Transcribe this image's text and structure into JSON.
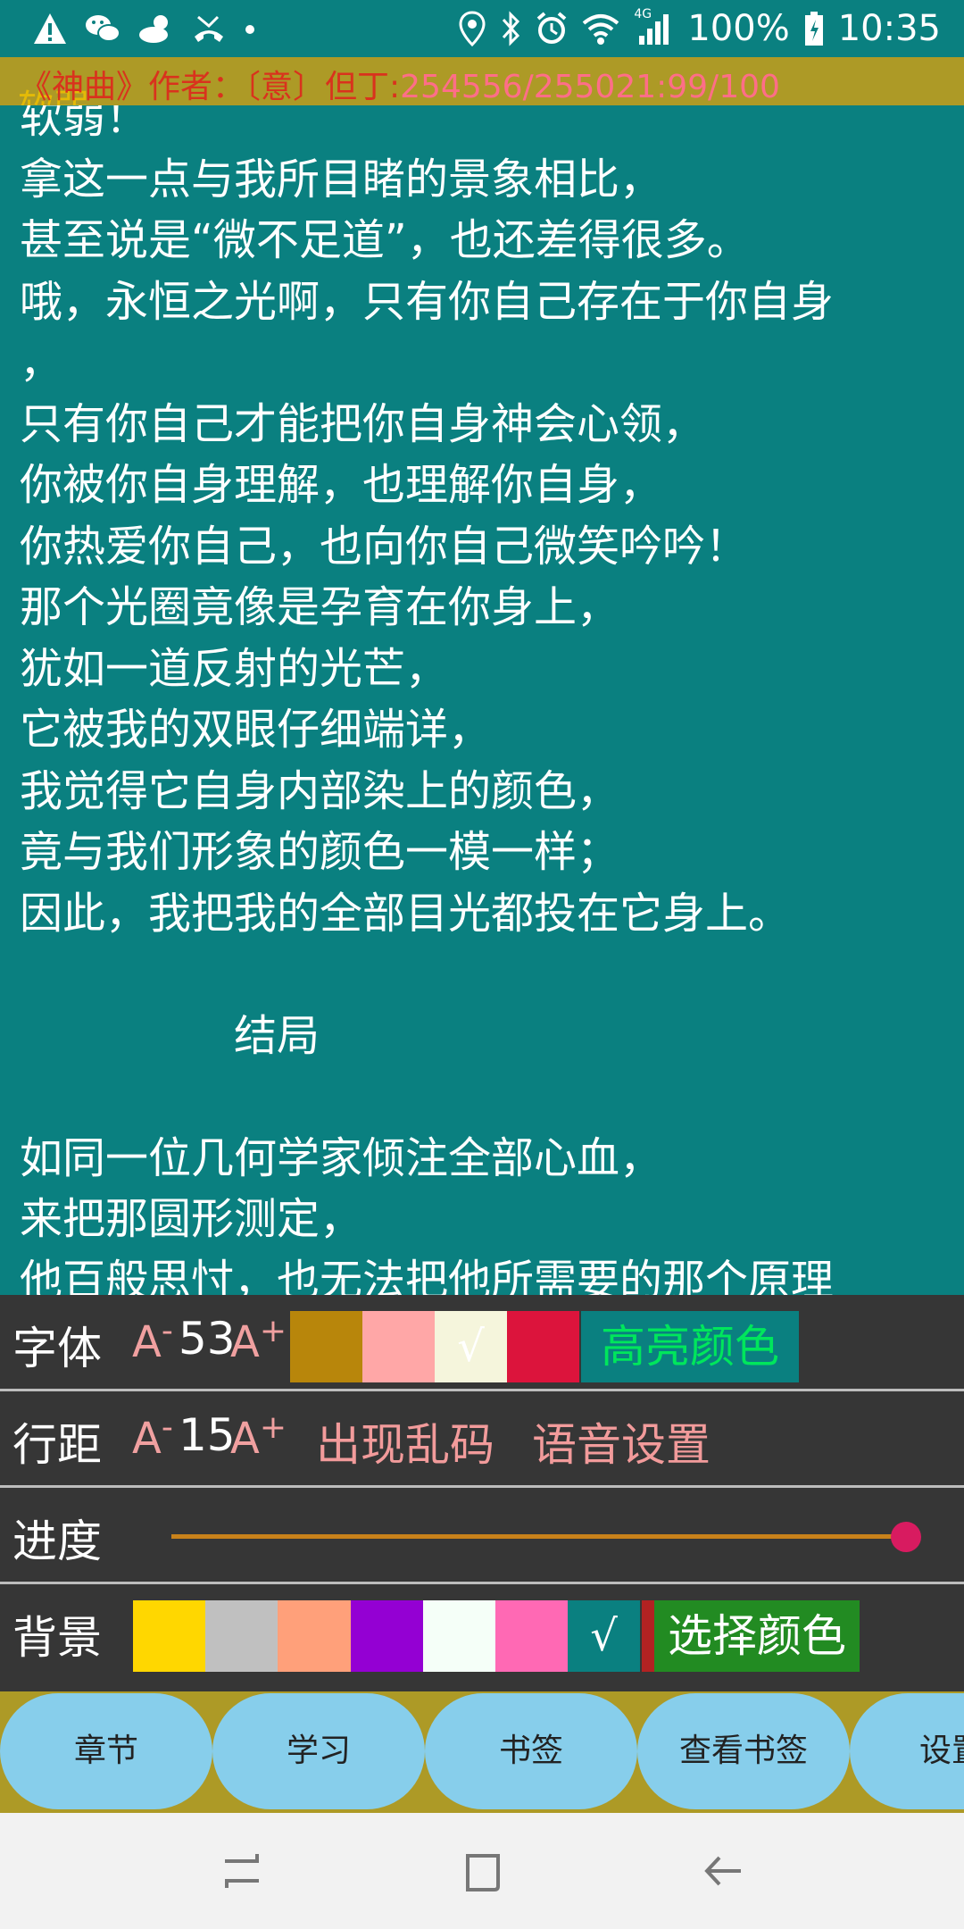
{
  "status_bar": {
    "icons_left": [
      "warning-icon",
      "wechat-icon",
      "weather-icon",
      "missed-call-icon",
      "dot-icon"
    ],
    "icons_right": [
      "location-icon",
      "bluetooth-icon",
      "alarm-icon",
      "wifi-icon",
      "signal-icon",
      "battery-icon"
    ],
    "network_label": "4G",
    "battery": "100%",
    "time": "10:35"
  },
  "header": {
    "book": "《神曲》作者：〔意〕但丁:",
    "progress": "254556/255021:99/100",
    "ghost_text": "软弱"
  },
  "reader": {
    "lines": [
      "软弱！",
      "拿这一点与我所目睹的景象相比，",
      "甚至说是“微不足道”，也还差得很多。",
      "哦，永恒之光啊，只有你自己存在于你自身",
      "，",
      "只有你自己才能把你自身神会心领，",
      "你被你自身理解，也理解你自身，",
      "你热爱你自己，也向你自己微笑吟吟！",
      "那个光圈竟像是孕育在你身上，",
      "犹如一道反射的光芒，",
      "它被我的双眼仔细端详，",
      "我觉得它自身内部染上的颜色，",
      "竟与我们形象的颜色一模一样；",
      "因此，我把我的全部目光都投在它身上。",
      "",
      "　　　　　结局",
      "",
      "如同一位几何学家倾注全部心血，",
      "来把那圆形测定，",
      "他百般思忖，也无法把他所需要的那个原理"
    ]
  },
  "settings": {
    "font": {
      "label": "字体",
      "minus": "A",
      "size": "53",
      "plus": "A",
      "check": "√",
      "highlight_label": "高亮颜色",
      "swatches": [
        "#b8860b",
        "#ffa7a7",
        "#f5f5dc",
        "#dc143c"
      ],
      "highlight_bg": "#0a8080",
      "highlight_color": "#00e65c"
    },
    "spacing": {
      "label": "行距",
      "minus": "A",
      "size": "15",
      "plus": "A",
      "garbled": "出现乱码",
      "voice": "语音设置"
    },
    "progress": {
      "label": "进度",
      "value": 0.99
    },
    "background": {
      "label": "背景",
      "check": "√",
      "choose_label": "选择颜色",
      "swatches": [
        "#ffd700",
        "#c0c0c0",
        "#ffa07a",
        "#9400d3",
        "#f5fff8",
        "#ff69b4",
        "#0a8080"
      ]
    }
  },
  "nav_buttons": [
    "章节",
    "学习",
    "书签",
    "查看书签",
    "设置"
  ],
  "colors": {
    "reader_bg": "#0a8080",
    "header_bg": "#ad9a26",
    "panel_bg": "#363636",
    "button_bg": "#87ceeb",
    "slider_thumb": "#d81b60"
  }
}
